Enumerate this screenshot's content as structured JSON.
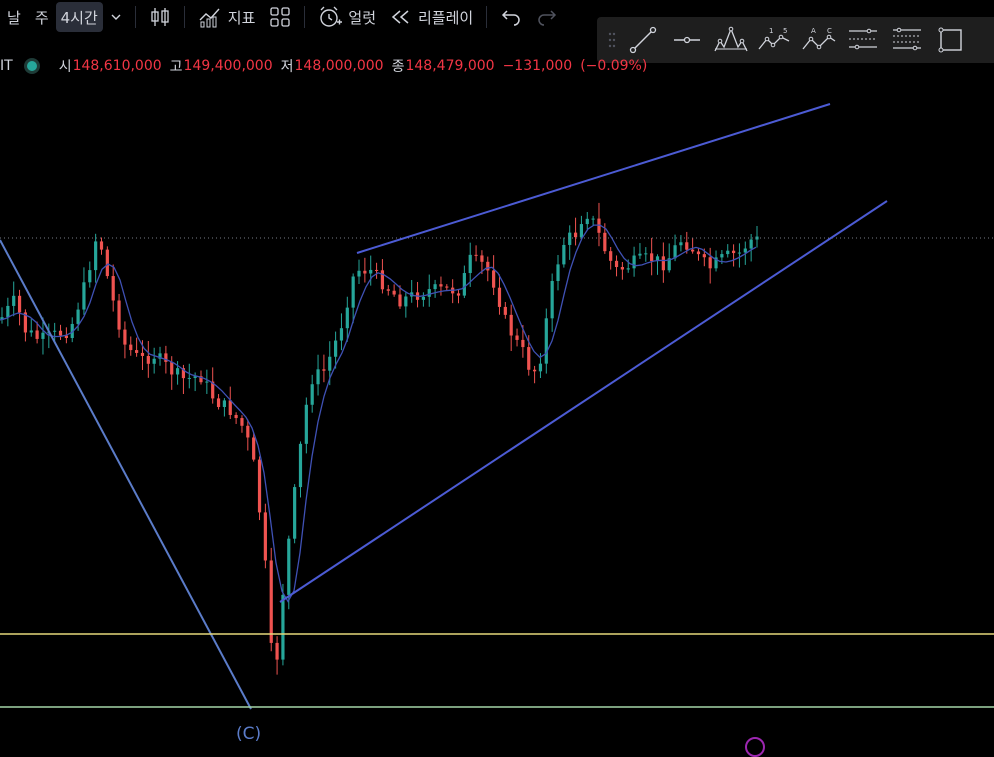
{
  "toolbar": {
    "timeframes": [
      "날",
      "주",
      "4시간"
    ],
    "active_timeframe": "4시간",
    "indicators_label": "지표",
    "alert_label": "얼럿",
    "replay_label": "리플레이"
  },
  "legend": {
    "symbol_suffix": "IT",
    "open_label": "시",
    "open_value": "148,610,000",
    "high_label": "고",
    "high_value": "149,400,000",
    "low_label": "저",
    "low_value": "148,000,000",
    "close_label": "종",
    "close_value": "148,479,000",
    "change": "−131,000",
    "change_pct": "(−0.09%)"
  },
  "chart_data": {
    "type": "candlestick",
    "up_color": "#26a69a",
    "down_color": "#ef5350",
    "ma_color": "#3f51b5",
    "wave_label": "(C)"
  },
  "colors": {
    "trendline": "#4c5bd4",
    "downtrend": "#5b7cc9",
    "support_yellow": "#e6d77a",
    "support_green": "#a5d6a7"
  },
  "icons": {
    "drawing_tools": [
      "grip-icon",
      "trend-line-icon",
      "horizontal-ray-icon",
      "head-shoulders-icon",
      "elliott-impulse-icon",
      "elliott-correction-icon",
      "parallel-channel-icon",
      "fib-retracement-icon",
      "rectangle-icon"
    ]
  }
}
